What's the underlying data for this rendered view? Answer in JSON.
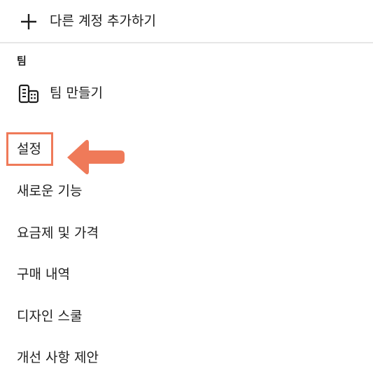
{
  "account": {
    "add_label": "다른 계정 추가하기",
    "add_icon": "plus-icon"
  },
  "team": {
    "heading": "팀",
    "create_label": "팀 만들기",
    "create_icon": "team-building-icon"
  },
  "menu": {
    "items": [
      {
        "label": "설정",
        "highlighted": true
      },
      {
        "label": "새로운 기능"
      },
      {
        "label": "요금제 및 가격"
      },
      {
        "label": "구매 내역"
      },
      {
        "label": "디자인 스쿨"
      },
      {
        "label": "개선 사항 제안"
      }
    ]
  },
  "annotation": {
    "accent_color": "#ef7a59",
    "pointer_icon": "arrow-left-icon"
  }
}
